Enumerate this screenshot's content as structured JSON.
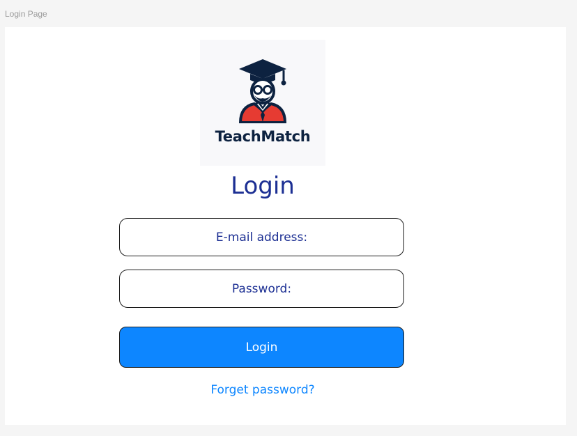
{
  "frame": {
    "label": "Login Page"
  },
  "logo": {
    "icon": "graduate-teacher-icon",
    "brand_name": "TeachMatch",
    "colors": {
      "navy": "#0d2240",
      "red": "#e63b32",
      "skin": "#ffffff"
    }
  },
  "page": {
    "title": "Login"
  },
  "form": {
    "email_placeholder": "E-mail address:",
    "password_placeholder": "Password:",
    "login_label": "Login",
    "forgot_label": "Forget password?"
  },
  "colors": {
    "background": "#f5f5f5",
    "card": "#ffffff",
    "title": "#1c2f93",
    "primary": "#0d86ff",
    "border": "#1b1b1b"
  }
}
